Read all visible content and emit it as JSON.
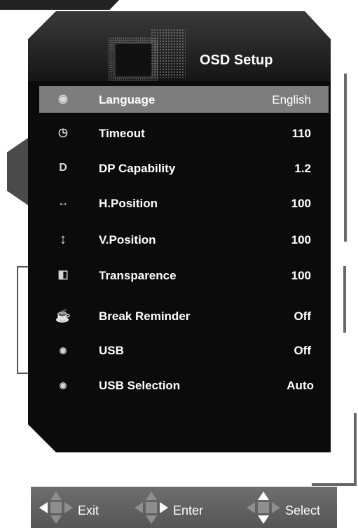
{
  "osd": {
    "title": "OSD Setup",
    "items": [
      {
        "icon": "globe-icon",
        "label": "Language",
        "value": "English",
        "selected": true
      },
      {
        "icon": "timer-icon",
        "label": "Timeout",
        "value": "110"
      },
      {
        "icon": "displayport-icon",
        "label": "DP Capability",
        "value": "1.2"
      },
      {
        "icon": "horizontal-arrows-icon",
        "label": "H.Position",
        "value": "100"
      },
      {
        "icon": "vertical-arrows-icon",
        "label": "V.Position",
        "value": "100"
      },
      {
        "icon": "transparency-icon",
        "label": "Transparence",
        "value": "100"
      },
      {
        "icon": "coffee-cup-icon",
        "label": "Break Reminder",
        "value": "Off"
      },
      {
        "icon": "usb-icon",
        "label": "USB",
        "value": "Off"
      },
      {
        "icon": "usb-selection-icon",
        "label": "USB Selection",
        "value": "Auto"
      }
    ]
  },
  "footer": {
    "exit_label": "Exit",
    "enter_label": "Enter",
    "select_label": "Select"
  },
  "colors": {
    "panel_bg": "#0b0b0b",
    "selected_row_bg": "#7d7d7d",
    "footer_bg": "#5f5f5f",
    "text": "#ffffff"
  }
}
